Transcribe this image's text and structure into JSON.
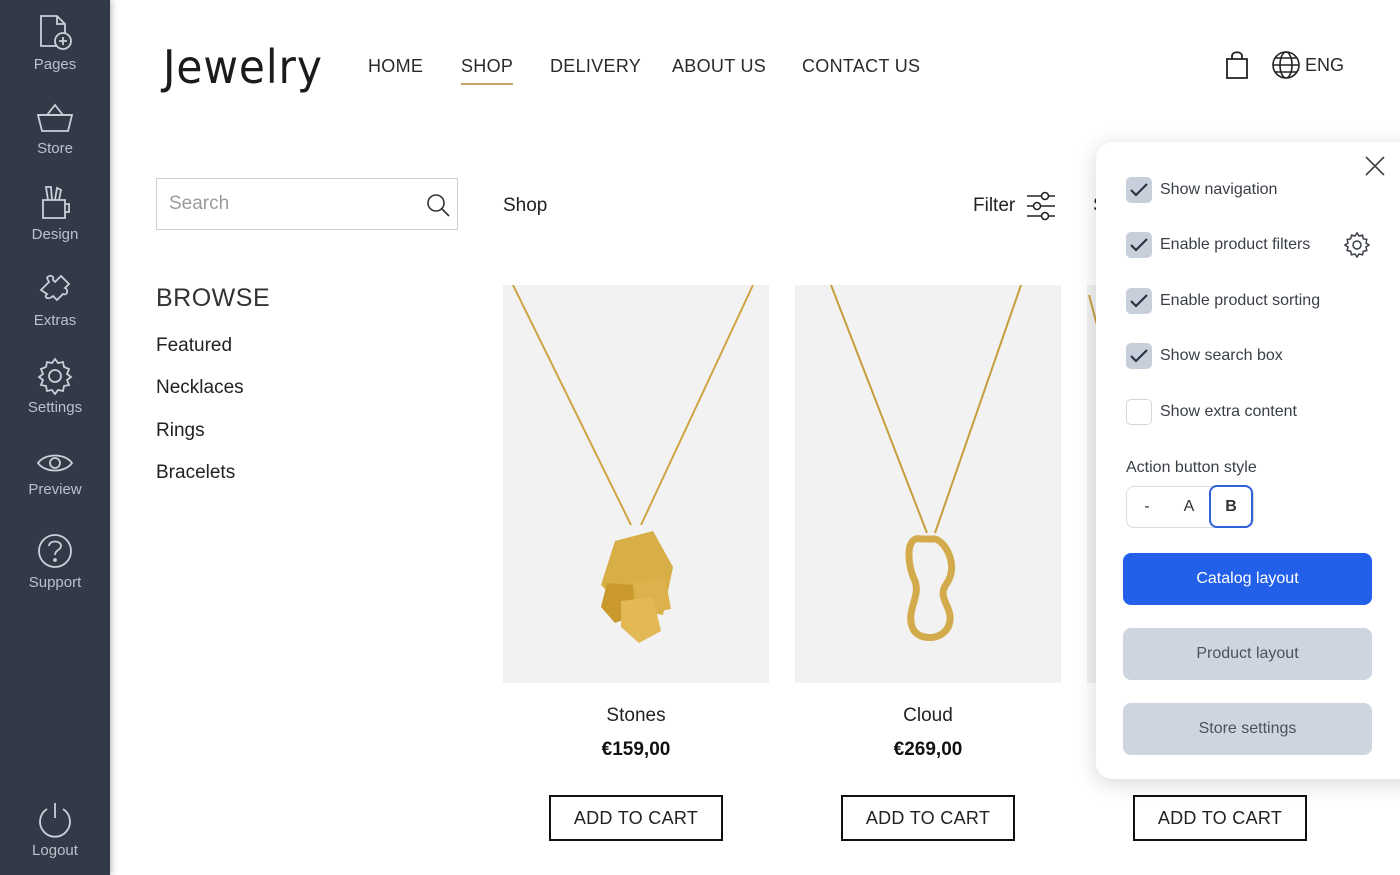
{
  "sidebar": {
    "items": [
      {
        "label": "Pages",
        "icon": "pages-add-icon"
      },
      {
        "label": "Store",
        "icon": "basket-icon"
      },
      {
        "label": "Design",
        "icon": "design-tools-icon"
      },
      {
        "label": "Extras",
        "icon": "puzzle-icon"
      },
      {
        "label": "Settings",
        "icon": "gear-icon"
      },
      {
        "label": "Preview",
        "icon": "eye-icon"
      },
      {
        "label": "Support",
        "icon": "question-icon"
      }
    ],
    "logout": {
      "label": "Logout",
      "icon": "power-icon"
    }
  },
  "header": {
    "logo": "Jewelry",
    "nav": [
      "HOME",
      "SHOP",
      "DELIVERY",
      "ABOUT US",
      "CONTACT US"
    ],
    "active_nav": "SHOP",
    "language": "ENG"
  },
  "search": {
    "placeholder": "Search"
  },
  "browse": {
    "title": "BROWSE",
    "items": [
      "Featured",
      "Necklaces",
      "Rings",
      "Bracelets"
    ]
  },
  "shop": {
    "title": "Shop",
    "filter_label": "Filter",
    "sort_peek": "S"
  },
  "products": [
    {
      "name": "Stones",
      "price": "€159,00",
      "button": "ADD TO CART"
    },
    {
      "name": "Cloud",
      "price": "€269,00",
      "button": "ADD TO CART"
    },
    {
      "name": "",
      "price": "",
      "button": "ADD TO CART"
    }
  ],
  "panel": {
    "options": [
      {
        "label": "Show navigation",
        "checked": true
      },
      {
        "label": "Enable product filters",
        "checked": true
      },
      {
        "label": "Enable product sorting",
        "checked": true
      },
      {
        "label": "Show search box",
        "checked": true
      },
      {
        "label": "Show extra content",
        "checked": false
      }
    ],
    "action_style_label": "Action button style",
    "action_styles": [
      "-",
      "A",
      "B"
    ],
    "action_style_selected": "B",
    "buttons": {
      "catalog": "Catalog layout",
      "product": "Product layout",
      "store": "Store settings"
    },
    "colors": {
      "primary": "#2360ea",
      "secondary": "#cdd5e0",
      "checkbox": "#c7cfdb"
    }
  },
  "colors": {
    "sidebar": "#313a46",
    "nav_underline": "#c9a56b",
    "product_bg": "#f2f2f3"
  }
}
